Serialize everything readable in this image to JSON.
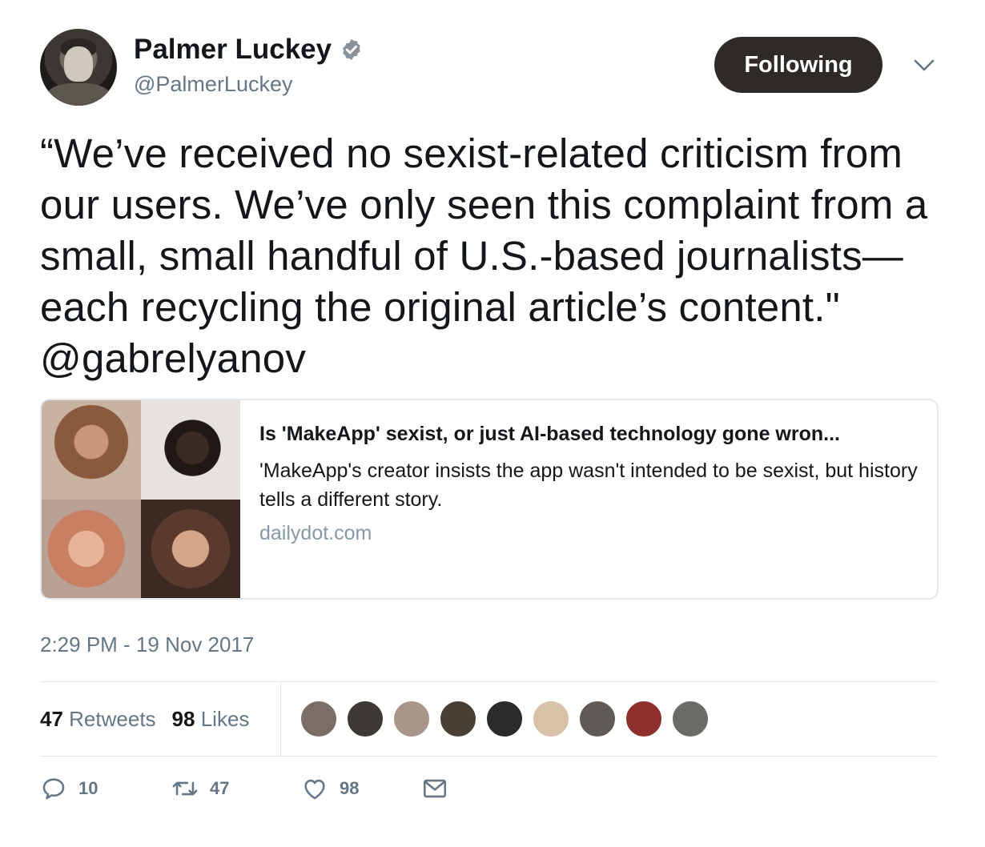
{
  "author": {
    "name": "Palmer Luckey",
    "handle": "@PalmerLuckey",
    "verified": true,
    "verified_icon": "verified-badge-icon"
  },
  "follow_button": {
    "label": "Following"
  },
  "menu": {
    "icon": "chevron-down-icon"
  },
  "tweet": {
    "text": "“We’ve received no sexist-related criticism from our users. We’ve only seen this complaint from a small, small handful of U.S.-based journalists—each recycling the original article’s content.\" @gabrelyanov"
  },
  "card": {
    "title": "Is 'MakeApp' sexist, or just AI-based technology gone wron...",
    "description": "'MakeApp's creator insists the app wasn't intended to be sexist, but history tells a different story.",
    "domain": "dailydot.com"
  },
  "timestamp": "2:29 PM - 19 Nov 2017",
  "stats": {
    "retweets_count": "47",
    "retweets_label": "Retweets",
    "likes_count": "98",
    "likes_label": "Likes"
  },
  "liker_avatars": [
    {
      "color": "#7a6e66"
    },
    {
      "color": "#3d3a36"
    },
    {
      "color": "#a9958a"
    },
    {
      "color": "#4a3f35"
    },
    {
      "color": "#2d2b29"
    },
    {
      "color": "#d8c2a8"
    },
    {
      "color": "#5f5a55"
    },
    {
      "color": "#8e2f2b"
    },
    {
      "color": "#6b6a66"
    }
  ],
  "actions": {
    "reply_count": "10",
    "retweet_count": "47",
    "like_count": "98"
  },
  "colors": {
    "text_primary": "#14171a",
    "text_secondary": "#657786",
    "button_bg": "#2e2a27",
    "border": "#e1e8ed"
  }
}
